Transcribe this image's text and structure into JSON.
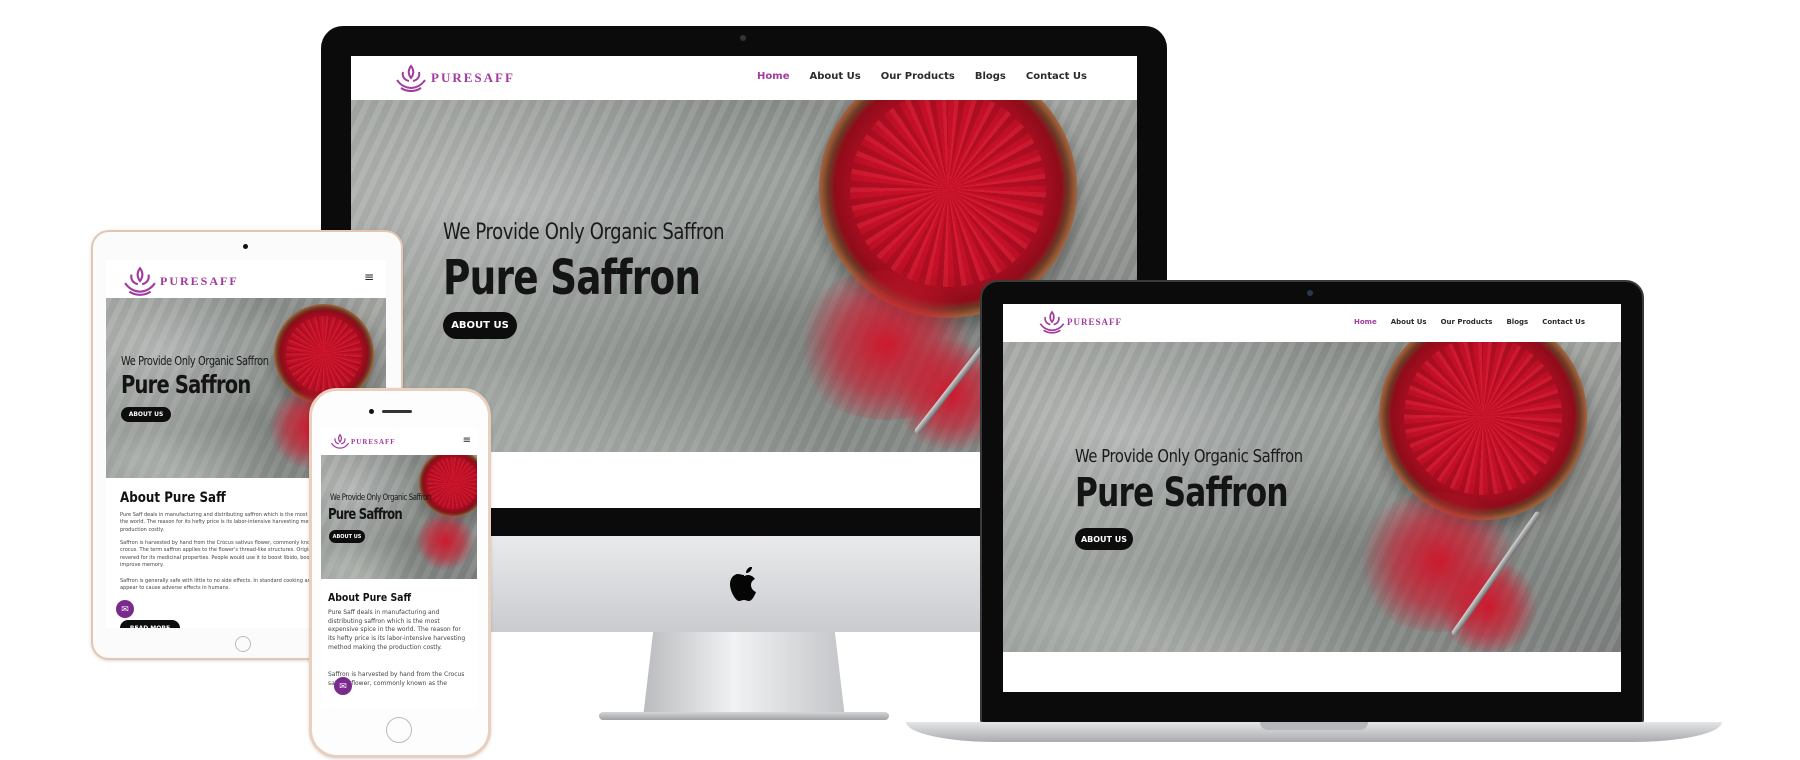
{
  "brand": {
    "logo_text": "PURESAFF",
    "accent": "#a13b9f",
    "logo_icon": "lotus-flame-icon"
  },
  "nav": {
    "items": [
      {
        "label": "Home",
        "active": true
      },
      {
        "label": "About Us",
        "active": false
      },
      {
        "label": "Our Products",
        "active": false
      },
      {
        "label": "Blogs",
        "active": false
      },
      {
        "label": "Contact Us",
        "active": false
      }
    ]
  },
  "hero": {
    "subtitle": "We Provide Only Organic Saffron",
    "title": "Pure Saffron",
    "button": "ABOUT US"
  },
  "about": {
    "title": "About Pure Saff",
    "tablet_paragraphs": [
      "Pure Saff deals in manufacturing and distributing saffron which is the most expensive spice in the world. The reason for its hefty price is its labor-intensive harvesting method making the production costly.",
      "Saffron is harvested by hand from the Crocus sativus flower, commonly known as the saffron crocus. The term saffron applies to the flower's thread-like structures. Originated and long revered for its medicinal properties. People would use it to boost libido, boost mood and improve memory.",
      "Saffron is generally safe with little to no side effects. In standard cooking amounts, it does not appear to cause adverse effects in humans."
    ],
    "phone_text": "Pure Saff deals in manufacturing and distributing saffron which is the most expensive spice in the world. The reason for its hefty price is its labor-intensive harvesting method making the production costly.",
    "phone_text2": "Saffron is harvested by hand from the Crocus sativus flower, commonly known as the",
    "read_more": "READ MORE"
  },
  "icons": {
    "menu": "≡",
    "chat": "chat-bubble-icon",
    "apple": "apple-logo-icon"
  }
}
